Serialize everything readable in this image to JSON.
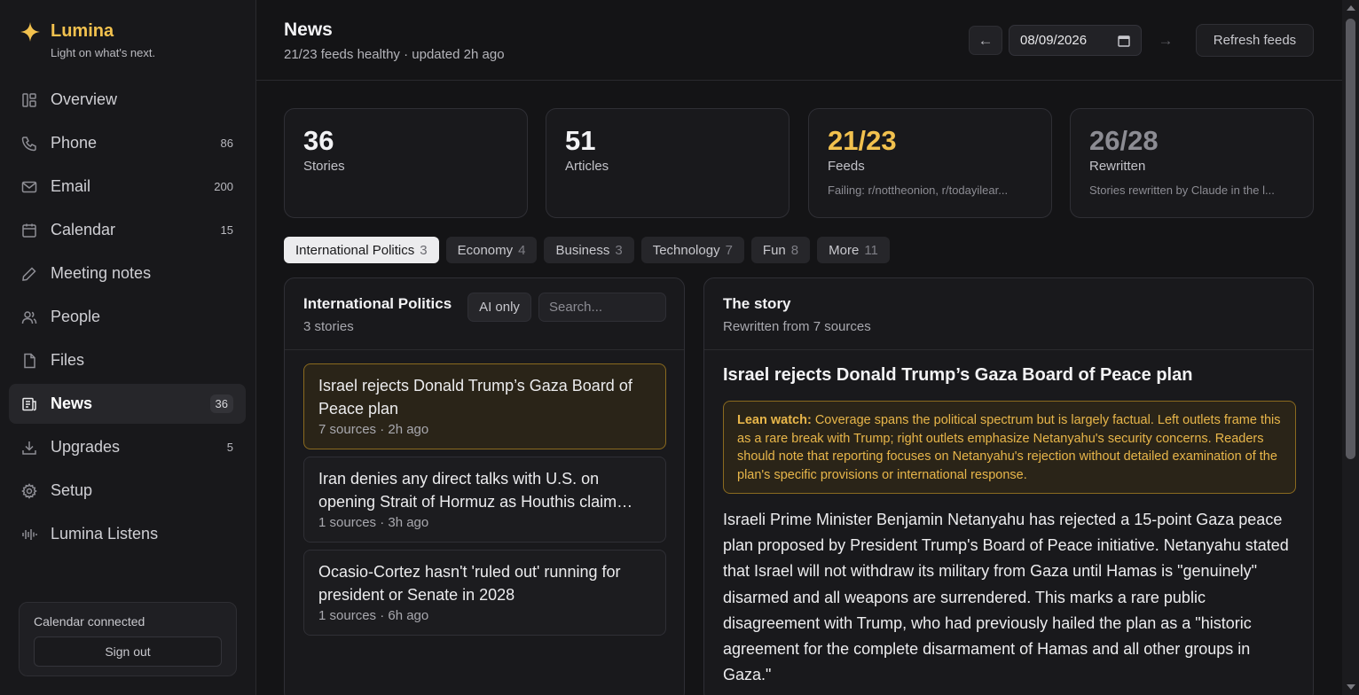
{
  "brand": {
    "name": "Lumina",
    "tagline": "Light on what's next."
  },
  "nav": [
    {
      "label": "Overview",
      "icon": "overview-icon",
      "count": ""
    },
    {
      "label": "Phone",
      "icon": "phone-icon",
      "count": "86"
    },
    {
      "label": "Email",
      "icon": "mail-icon",
      "count": "200"
    },
    {
      "label": "Calendar",
      "icon": "calendar-icon",
      "count": "15"
    },
    {
      "label": "Meeting notes",
      "icon": "pen-icon",
      "count": ""
    },
    {
      "label": "People",
      "icon": "people-icon",
      "count": ""
    },
    {
      "label": "Files",
      "icon": "file-icon",
      "count": ""
    },
    {
      "label": "News",
      "icon": "news-icon",
      "count": "36",
      "active": true
    },
    {
      "label": "Upgrades",
      "icon": "download-icon",
      "count": "5"
    },
    {
      "label": "Setup",
      "icon": "gear-icon",
      "count": ""
    },
    {
      "label": "Lumina Listens",
      "icon": "waveform-icon",
      "count": ""
    }
  ],
  "calendar_box": {
    "status": "Calendar connected",
    "signout": "Sign out"
  },
  "header": {
    "title": "News",
    "subtitle": "21/23 feeds healthy · updated 2h ago",
    "prev": "←",
    "date": "08/09/2026",
    "next": "→",
    "refresh": "Refresh feeds"
  },
  "stats": [
    {
      "value": "36",
      "label": "Stories",
      "note": ""
    },
    {
      "value": "51",
      "label": "Articles",
      "note": ""
    },
    {
      "value": "21/23",
      "label": "Feeds",
      "note": "Failing: r/nottheonion, r/todayilear..."
    },
    {
      "value": "26/28",
      "label": "Rewritten",
      "note": "Stories rewritten by Claude in the l..."
    }
  ],
  "tabs": [
    {
      "label": "International Politics",
      "count": "3",
      "active": true
    },
    {
      "label": "Economy",
      "count": "4"
    },
    {
      "label": "Business",
      "count": "3"
    },
    {
      "label": "Technology",
      "count": "7"
    },
    {
      "label": "Fun",
      "count": "8"
    },
    {
      "label": "More",
      "count": "11"
    }
  ],
  "list": {
    "title": "International Politics",
    "subtitle": "3 stories",
    "ai_only": "AI only",
    "search_placeholder": "Search...",
    "stories": [
      {
        "title": "Israel rejects Donald Trump’s Gaza Board of Peace plan",
        "meta": "7 sources · 2h ago"
      },
      {
        "title": "Iran denies any direct talks with U.S. on opening Strait of Hormuz as Houthis claim…",
        "meta": "1 sources · 3h ago"
      },
      {
        "title": "Ocasio-Cortez hasn't 'ruled out' running for president or Senate in 2028",
        "meta": "1 sources · 6h ago"
      }
    ]
  },
  "detail": {
    "title": "The story",
    "subtitle": "Rewritten from 7 sources",
    "headline": "Israel rejects Donald Trump’s Gaza Board of Peace plan",
    "lean_label": "Lean watch:",
    "lean_text": "Coverage spans the political spectrum but is largely factual. Left outlets frame this as a rare break with Trump; right outlets emphasize Netanyahu's security concerns. Readers should note that reporting focuses on Netanyahu's rejection without detailed examination of the plan's specific provisions or international response.",
    "body": "Israeli Prime Minister Benjamin Netanyahu has rejected a 15-point Gaza peace plan proposed by President Trump's Board of Peace initiative. Netanyahu stated that Israel will not withdraw its military from Gaza until Hamas is \"genuinely\" disarmed and all weapons are surrendered. This marks a rare public disagreement with Trump, who had previously hailed the plan as a \"historic agreement for the complete disarmament of Hamas and all other groups in Gaza.\""
  },
  "colors": {
    "accent": "#f2c14e",
    "background": "#141416",
    "panel": "#19191c"
  }
}
